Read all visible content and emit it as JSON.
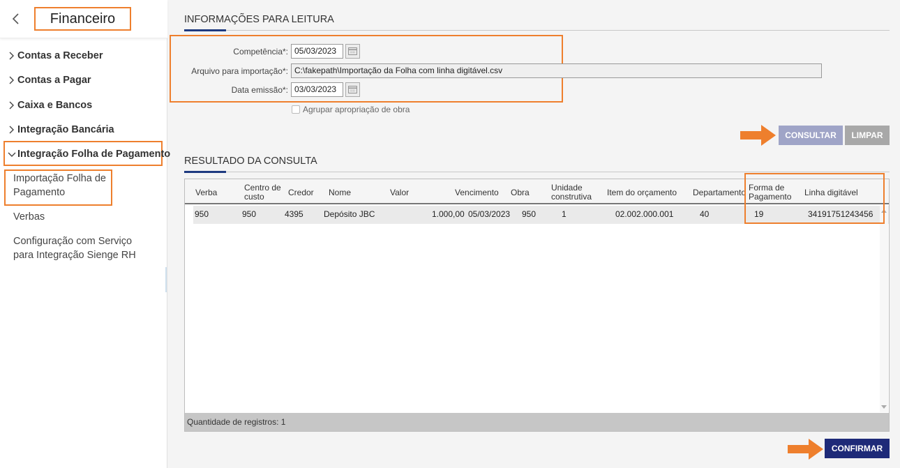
{
  "sidebar": {
    "title": "Financeiro",
    "menu": [
      {
        "label": "Contas a Receber"
      },
      {
        "label": "Contas a Pagar"
      },
      {
        "label": "Caixa e Bancos"
      },
      {
        "label": "Integração Bancária"
      },
      {
        "label": "Integração Folha de Pagamento"
      }
    ],
    "subitems": [
      {
        "label": "Importação Folha de Pagamento"
      },
      {
        "label": "Verbas"
      },
      {
        "label": "Configuração com Serviço para Integração Sienge RH"
      }
    ]
  },
  "form": {
    "section_title": "INFORMAÇÕES PARA LEITURA",
    "competencia_label": "Competência*:",
    "competencia_value": "05/03/2023",
    "arquivo_label": "Arquivo para importação*:",
    "arquivo_value": "C:\\fakepath\\Importação da Folha com linha digitável.csv",
    "data_emissao_label": "Data emissão*:",
    "data_emissao_value": "03/03/2023",
    "agrupar_label": "Agrupar apropriação de obra"
  },
  "buttons": {
    "consultar": "CONSULTAR",
    "limpar": "LIMPAR",
    "confirmar": "CONFIRMAR"
  },
  "results": {
    "section_title": "RESULTADO DA CONSULTA",
    "columns": {
      "verba": "Verba",
      "centro_custo": "Centro de custo",
      "credor": "Credor",
      "nome": "Nome",
      "valor": "Valor",
      "vencimento": "Vencimento",
      "obra": "Obra",
      "unidade": "Unidade construtiva",
      "item_orcamento": "Item do orçamento",
      "departamento": "Departamento",
      "forma_pagamento": "Forma de Pagamento",
      "linha_digitavel": "Linha digitável"
    },
    "row": {
      "verba": "950",
      "centro_custo": "950",
      "credor": "4395",
      "nome": "Depósito JBC",
      "valor": "1.000,00",
      "vencimento": "05/03/2023",
      "obra": "950",
      "unidade": "1",
      "item_orcamento": "02.002.000.001",
      "departamento": "40",
      "forma_pagamento": "19",
      "linha_digitavel": "34191751243456"
    },
    "footer": "Quantidade de registros: 1"
  },
  "colors": {
    "highlight": "#ee7f2d",
    "consultar": "#9fa4c7",
    "limpar": "#a8a8a8",
    "confirmar": "#1e2a78",
    "accent": "#1e3a80"
  }
}
